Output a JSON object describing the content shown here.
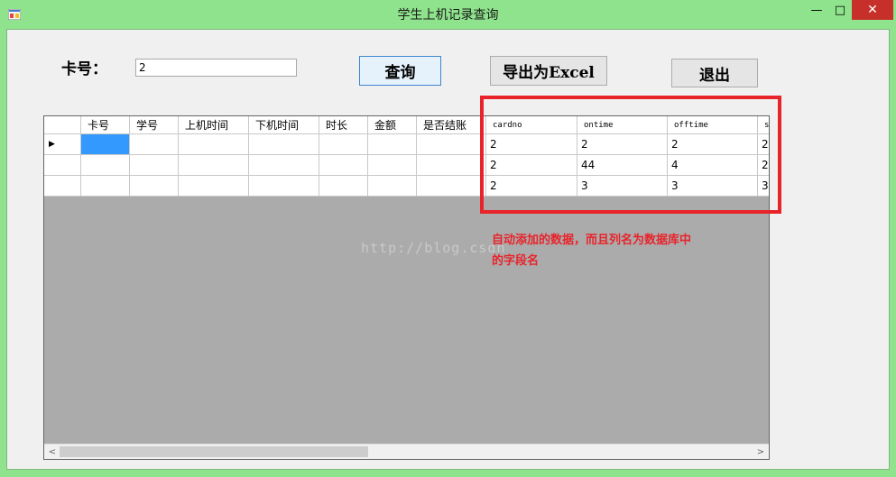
{
  "window": {
    "title": "学生上机记录查询",
    "minimize_glyph": "—",
    "maximize_glyph": "□",
    "close_glyph": "✕"
  },
  "form": {
    "card_label": "卡号：",
    "card_value": "2",
    "query_button": "查询",
    "export_button": "导出为Excel",
    "exit_button": "退出"
  },
  "grid": {
    "columns": [
      "卡号",
      "学号",
      "上机时间",
      "下机时间",
      "时长",
      "金额",
      "是否结账",
      "cardno",
      "ontime",
      "offtime",
      "s"
    ],
    "rows": [
      [
        "",
        "",
        "",
        "",
        "",
        "",
        "",
        "2",
        "2",
        "2",
        "2"
      ],
      [
        "",
        "",
        "",
        "",
        "",
        "",
        "",
        "2",
        "44",
        "4",
        "2"
      ],
      [
        "",
        "",
        "",
        "",
        "",
        "",
        "",
        "2",
        "3",
        "3",
        "3"
      ]
    ],
    "current_row_glyph": "▶",
    "scroll_left_glyph": "<",
    "scroll_right_glyph": ">"
  },
  "overlay": {
    "watermark": "http://blog.csdn",
    "annotation_line1": "自动添加的数据，而且列名为数据库中",
    "annotation_line2": "的字段名",
    "accent_color": "#e8232a"
  }
}
